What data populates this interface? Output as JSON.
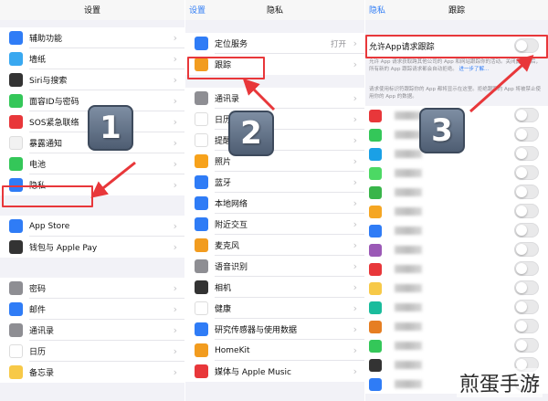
{
  "settings": {
    "title": "设置",
    "items": [
      {
        "label": "辅助功能",
        "icon": "accessibility-icon",
        "color": "#2f7cf6"
      },
      {
        "label": "墙纸",
        "icon": "wallpaper-icon",
        "color": "#39a8f0"
      },
      {
        "label": "Siri与搜索",
        "icon": "siri-icon",
        "color": "#333"
      },
      {
        "label": "面容ID与密码",
        "icon": "faceid-icon",
        "color": "#34c759"
      },
      {
        "label": "SOS紧急联络",
        "icon": "sos-icon",
        "color": "#e8373a"
      },
      {
        "label": "暴露通知",
        "icon": "exposure-icon",
        "color": "#f2f2f2"
      },
      {
        "label": "电池",
        "icon": "battery-icon",
        "color": "#34c759"
      },
      {
        "label": "隐私",
        "icon": "hand-icon",
        "color": "#2f7cf6"
      },
      {
        "label": "App Store",
        "icon": "appstore-icon",
        "color": "#2f7cf6"
      },
      {
        "label": "钱包与 Apple Pay",
        "icon": "wallet-icon",
        "color": "#333"
      },
      {
        "label": "密码",
        "icon": "key-icon",
        "color": "#8e8e93"
      },
      {
        "label": "邮件",
        "icon": "mail-icon",
        "color": "#2f7cf6"
      },
      {
        "label": "通讯录",
        "icon": "contacts-icon",
        "color": "#8e8e93"
      },
      {
        "label": "日历",
        "icon": "calendar-icon",
        "color": "#fff"
      },
      {
        "label": "备忘录",
        "icon": "notes-icon",
        "color": "#f7c948"
      }
    ]
  },
  "privacy": {
    "back": "设置",
    "title": "隐私",
    "items": [
      {
        "label": "定位服务",
        "icon": "location-icon",
        "color": "#2f7cf6",
        "value": "打开"
      },
      {
        "label": "跟踪",
        "icon": "tracking-icon",
        "color": "#f29c1f"
      },
      {
        "label": "通讯录",
        "icon": "contacts-icon",
        "color": "#8e8e93"
      },
      {
        "label": "日历",
        "icon": "calendar-icon",
        "color": "#fff"
      },
      {
        "label": "提醒事项",
        "icon": "reminders-icon",
        "color": "#fff"
      },
      {
        "label": "照片",
        "icon": "photos-icon",
        "color": "#f7a21b"
      },
      {
        "label": "蓝牙",
        "icon": "bluetooth-icon",
        "color": "#2f7cf6"
      },
      {
        "label": "本地网络",
        "icon": "network-icon",
        "color": "#2f7cf6"
      },
      {
        "label": "附近交互",
        "icon": "nearby-icon",
        "color": "#2f7cf6"
      },
      {
        "label": "麦克风",
        "icon": "microphone-icon",
        "color": "#f29c1f"
      },
      {
        "label": "语音识别",
        "icon": "speech-icon",
        "color": "#8e8e93"
      },
      {
        "label": "相机",
        "icon": "camera-icon",
        "color": "#333"
      },
      {
        "label": "健康",
        "icon": "health-icon",
        "color": "#fff"
      },
      {
        "label": "研究传感器与使用数据",
        "icon": "research-icon",
        "color": "#2f7cf6"
      },
      {
        "label": "HomeKit",
        "icon": "homekit-icon",
        "color": "#f29c1f"
      },
      {
        "label": "媒体与 Apple Music",
        "icon": "music-icon",
        "color": "#e8373a"
      }
    ]
  },
  "tracking": {
    "back": "隐私",
    "title": "跟踪",
    "allow_label": "允许App请求跟踪",
    "desc1": "允许 App 请求获取跨其他公司的 App 和网站跟踪你的活动。关闭此选项后，所有新的 App 跟踪请求都会自动拒绝。",
    "learn_more": "进一步了解...",
    "desc2": "请求使用标识符跟踪你的 App 都将显示在这里。拒绝跟踪的 App 将被禁止使用你的 App 的数据。",
    "apps": [
      {
        "color": "#e8373a"
      },
      {
        "color": "#34c759"
      },
      {
        "color": "#1aa0e6"
      },
      {
        "color": "#4cd964"
      },
      {
        "color": "#39b54a"
      },
      {
        "color": "#f5a623"
      },
      {
        "color": "#2f7cf6"
      },
      {
        "color": "#9b59b6"
      },
      {
        "color": "#e8373a"
      },
      {
        "color": "#f7c948"
      },
      {
        "color": "#1abc9c"
      },
      {
        "color": "#e67e22"
      },
      {
        "color": "#34c759"
      },
      {
        "color": "#333333"
      },
      {
        "color": "#2f7cf6"
      }
    ]
  },
  "steps": [
    "1",
    "2",
    "3"
  ],
  "watermark": "煎蛋手游"
}
